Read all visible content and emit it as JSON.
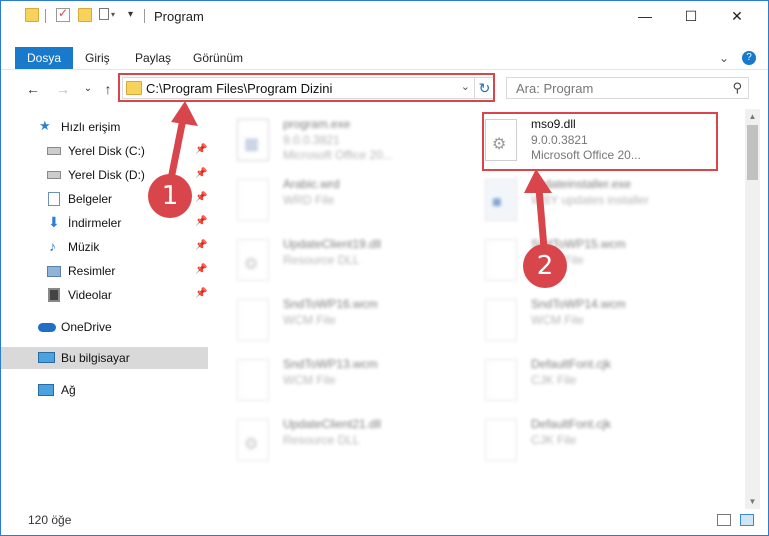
{
  "window": {
    "title": "Program",
    "minimize": "—",
    "maximize": "☐",
    "close": "✕"
  },
  "ribbon": {
    "tabs": [
      "Dosya",
      "Giriş",
      "Paylaş",
      "Görünüm"
    ],
    "expand_glyph": "⌄",
    "help_glyph": "?"
  },
  "address": {
    "path": "C:\\Program Files\\Program Dizini",
    "dropdown_glyph": "⌄",
    "refresh_glyph": "↻",
    "back_glyph": "←",
    "forward_glyph": "→",
    "recent_glyph": "⌄",
    "up_glyph": "↑"
  },
  "search": {
    "placeholder": "Ara: Program",
    "icon_glyph": "⚲"
  },
  "sidebar": {
    "items": [
      {
        "label": "Hızlı erişim",
        "icon": "star-icon",
        "pinned": false
      },
      {
        "label": "Yerel Disk (C:)",
        "icon": "drive-icon",
        "pinned": true
      },
      {
        "label": "Yerel Disk (D:)",
        "icon": "drive-icon",
        "pinned": true
      },
      {
        "label": "Belgeler",
        "icon": "documents-icon",
        "pinned": true
      },
      {
        "label": "İndirmeler",
        "icon": "download-icon",
        "pinned": true
      },
      {
        "label": "Müzik",
        "icon": "music-icon",
        "pinned": true
      },
      {
        "label": "Resimler",
        "icon": "pictures-icon",
        "pinned": true
      },
      {
        "label": "Videolar",
        "icon": "videos-icon",
        "pinned": true
      },
      {
        "label": "OneDrive",
        "icon": "cloud-icon",
        "pinned": false
      },
      {
        "label": "Bu bilgisayar",
        "icon": "computer-icon",
        "pinned": false
      },
      {
        "label": "Ağ",
        "icon": "network-icon",
        "pinned": false
      }
    ],
    "pin_glyph": "📌"
  },
  "files": [
    {
      "name": "program.exe",
      "line2": "9.0.0.3821",
      "line3": "Microsoft Office 20...",
      "blurred": true
    },
    {
      "name": "mso9.dll",
      "line2": "9.0.0.3821",
      "line3": "Microsoft Office 20...",
      "blurred": false
    },
    {
      "name": "Arabic.wrd",
      "line2": "WRD File",
      "line3": "",
      "blurred": true
    },
    {
      "name": "updateinstaller.exe",
      "line2": "WBY updates installer",
      "line3": "",
      "blurred": true
    },
    {
      "name": "UpdateClient19.dll",
      "line2": "Resource DLL",
      "line3": "",
      "blurred": true
    },
    {
      "name": "SndToWP15.wcm",
      "line2": "WCM File",
      "line3": "",
      "blurred": true
    },
    {
      "name": "SndToWP16.wcm",
      "line2": "WCM File",
      "line3": "",
      "blurred": true
    },
    {
      "name": "SndToWP14.wcm",
      "line2": "WCM File",
      "line3": "",
      "blurred": true
    },
    {
      "name": "SndToWP13.wcm",
      "line2": "WCM File",
      "line3": "",
      "blurred": true
    },
    {
      "name": "DefaultFont.cjk",
      "line2": "CJK File",
      "line3": "",
      "blurred": true
    },
    {
      "name": "UpdateClient21.dll",
      "line2": "Resource DLL",
      "line3": "",
      "blurred": true
    },
    {
      "name": "DefaultFont.cjk",
      "line2": "CJK File",
      "line3": "",
      "blurred": true
    }
  ],
  "status": {
    "item_count": "120 öğe"
  },
  "annotations": {
    "step1": "1",
    "step2": "2",
    "color": "#d8464c"
  }
}
